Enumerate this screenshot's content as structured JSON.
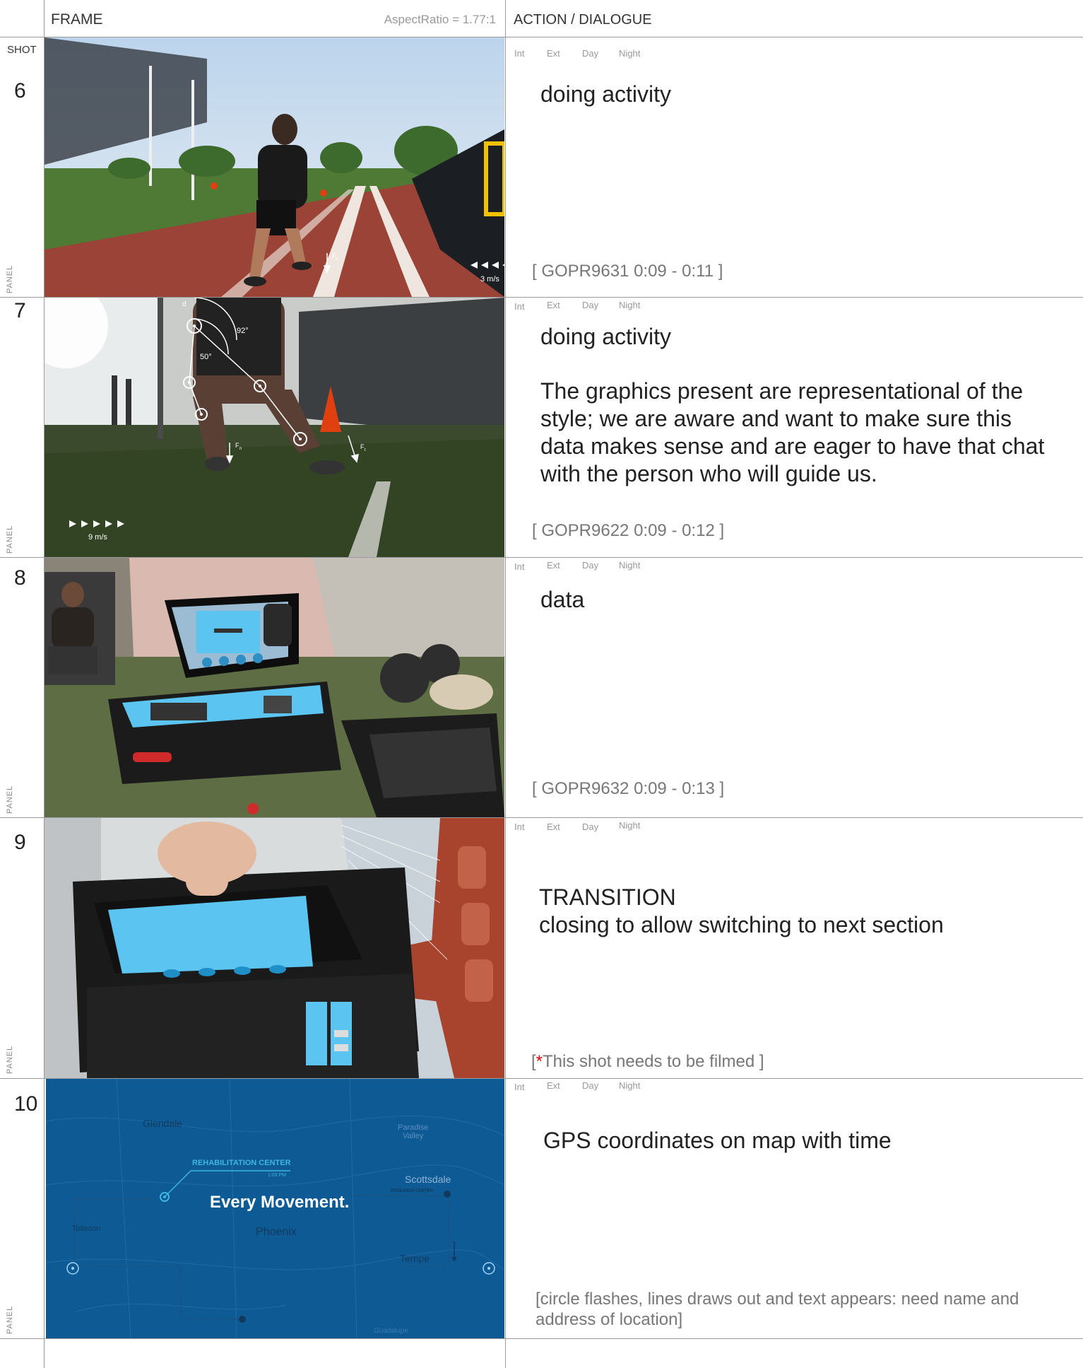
{
  "header": {
    "frame_label": "FRAME",
    "aspect_ratio": "AspectRatio = 1.77:1",
    "action_label": "ACTION  / DIALOGUE",
    "shot_label": "SHOT"
  },
  "ied_labels": {
    "int": "Int",
    "ext": "Ext",
    "day": "Day",
    "night": "Night"
  },
  "panel_label": "PANEL",
  "shots": [
    {
      "number": "6",
      "action": "doing activity",
      "note": "[ GOPR9631 0:09 - 0:11 ]",
      "overlay": {
        "speed": "3 m/s",
        "force": "F",
        "force_sub": "n"
      }
    },
    {
      "number": "7",
      "action": "doing activity",
      "action_extra": "The graphics present are representational of the style; we are aware and want to make sure this data makes sense and are eager to have that chat with the person who will guide us.",
      "note": "[ GOPR9622 0:09 - 0:12 ]",
      "overlay": {
        "angle1": "92°",
        "angle2": "50°",
        "d": "d",
        "speed": "9 m/s",
        "force1": "F",
        "force1_sub": "n",
        "force2": "F",
        "force2_sub": "t"
      }
    },
    {
      "number": "8",
      "action": "data",
      "note": "[ GOPR9632 0:09 - 0:13 ]"
    },
    {
      "number": "9",
      "action": "TRANSITION",
      "action_extra": "closing to allow switching to next section",
      "note_open": "[",
      "note_star": "*",
      "note_text": "This shot needs to be filmed ]"
    },
    {
      "number": "10",
      "action": "GPS coordinates on map with time",
      "note": "[circle flashes, lines draws out and text appears: need name and address of location]",
      "map": {
        "headline": "Every Movement.",
        "glendale": "Glendale",
        "paradise_valley_1": "Paradise",
        "paradise_valley_2": "Valley",
        "rehab": "REHABILITATION CENTER",
        "rehab_time": "1:03 PM",
        "scottsdale": "Scottsdale",
        "research": "RESEARCH CENTER",
        "tolleson": "Tolleson",
        "phoenix": "Phoenix",
        "tempe": "Tempe",
        "guadalupe": "Guadalupe"
      }
    }
  ],
  "colors": {
    "map_bg": "#0d5a94",
    "map_accent": "#3fb6e0",
    "note_red": "#dd0000",
    "case_blue": "#5cc4f0"
  }
}
